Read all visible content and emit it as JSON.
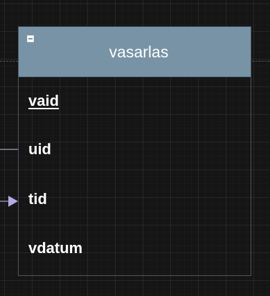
{
  "entity": {
    "title": "vasarlas",
    "attributes": [
      {
        "name": "vaid",
        "primary_key": true
      },
      {
        "name": "uid",
        "primary_key": false
      },
      {
        "name": "tid",
        "primary_key": false
      },
      {
        "name": "vdatum",
        "primary_key": false
      }
    ]
  },
  "colors": {
    "header": "#7893a6",
    "border": "#4c5866",
    "background": "#151515",
    "arrow": "#b5a9e6"
  },
  "icons": {
    "collapse": "minus-square-icon",
    "relation_end": "triangle-arrow-icon"
  }
}
